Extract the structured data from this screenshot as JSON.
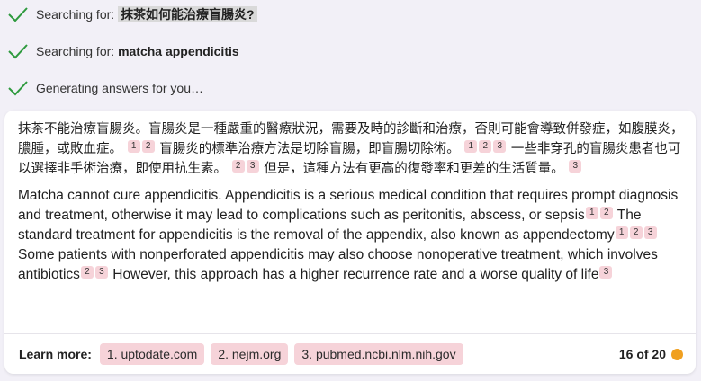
{
  "status": [
    {
      "prefix": "Searching for: ",
      "query": "抹茶如何能治療盲腸炎?"
    },
    {
      "prefix": "Searching for: ",
      "query": "matcha appendicitis"
    },
    {
      "prefix": "Generating answers for you…",
      "query": ""
    }
  ],
  "answer": {
    "zh": {
      "s1": "抹茶不能治療盲腸炎。盲腸炎是一種嚴重的醫療狀況，需要及時的診斷和治療，否則可能會導致併發症，如腹膜炎，膿腫，或敗血症。",
      "s2": " 盲腸炎的標準治療方法是切除盲腸，即盲腸切除術。",
      "s3": " 一些非穿孔的盲腸炎患者也可以選擇非手術治療，即使用抗生素。",
      "s4": " 但是，這種方法有更高的復發率和更差的生活質量。"
    },
    "en": {
      "s1": "Matcha cannot cure appendicitis. Appendicitis is a serious medical condition that requires prompt diagnosis and treatment, otherwise it may lead to complications such as peritonitis, abscess, or sepsis",
      "s2": " The standard treatment for appendicitis is the removal of the appendix, also known as appendectomy",
      "s3": " Some patients with nonperforated appendicitis may also choose nonoperative treatment, which involves antibiotics",
      "s4": " However, this approach has a higher recurrence rate and a worse quality of life"
    },
    "cites": {
      "c1": "1",
      "c2": "2",
      "c3": "3"
    }
  },
  "footer": {
    "learn_more": "Learn more:",
    "sources": [
      "1. uptodate.com",
      "2. nejm.org",
      "3. pubmed.ncbi.nlm.nih.gov"
    ],
    "counter": "16 of 20",
    "indicator_color": "#f0a020"
  },
  "colors": {
    "check": "#2e9a3e",
    "chip": "#f6d3d9",
    "background": "#f2f0f7"
  }
}
